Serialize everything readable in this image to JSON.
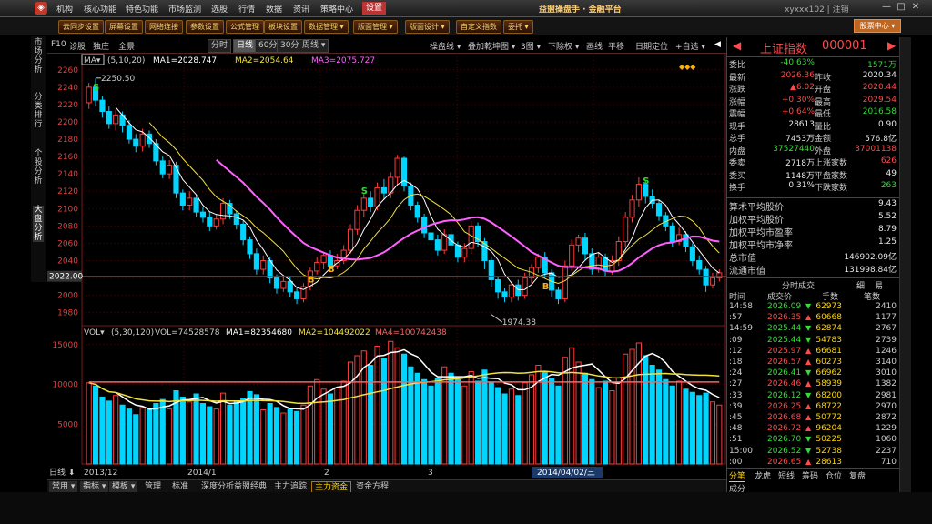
{
  "menu": {
    "items": [
      "机构",
      "核心功能",
      "特色功能",
      "市场监测",
      "选股",
      "行情",
      "数据",
      "资讯",
      "策略中心",
      "设置"
    ],
    "active_index": 9,
    "brand": "益盟操盘手 · 金融平台",
    "user": "xyxxx102 | 注销",
    "win_buttons": [
      "—",
      "□",
      "✕"
    ]
  },
  "toolbar": {
    "buttons": [
      "云同步设置",
      "屏幕设置",
      "网络连接",
      "参数设置",
      "公式管理",
      "板块设置",
      "数据管理 ▾",
      "版面管理 ▾",
      "版面设计 ▾",
      "自定义指数",
      "委托 ▾"
    ],
    "links": [
      "中国操盘手",
      "客服",
      "培训"
    ],
    "stock_center": "股票中心 ▾"
  },
  "vtabs": [
    "市场分析",
    "分类排行",
    "个股分析",
    "大盘分析"
  ],
  "chart_header": {
    "left": [
      "F10",
      "诊股",
      "独庄",
      "全景"
    ],
    "periods": [
      "分时",
      "日线",
      "60分",
      "30分",
      "周线 ▾"
    ],
    "selected_period": "日线",
    "right": [
      "操盘线 ▾",
      "叠加乾坤图 ▾",
      "3图 ▾",
      "下除权 ▾",
      "画线",
      "平移",
      "日期定位",
      "+自选 ▾"
    ]
  },
  "price_legend": {
    "ma_label": "MA▾",
    "params": "(5,10,20)",
    "ma1": "MA1=2028.747",
    "ma2": "MA2=2054.64",
    "ma3": "MA3=2075.727",
    "high_mark": "2250.50",
    "low_mark": "1974.38",
    "current_tag": "2022.00"
  },
  "vol_legend": {
    "label": "VOL▾",
    "params": "(5,30,120)",
    "vol": "VOL=74528578",
    "ma1": "MA1=82354680",
    "ma2": "MA2=104492022",
    "ma4": "MA4=100742438"
  },
  "x_axis": {
    "period_label": "日线",
    "ticks": [
      "2013/12",
      "2014/1",
      "2",
      "3"
    ],
    "cursor_date": "2014/04/02/三"
  },
  "bottom_tabs": [
    "常用 ▾",
    "指标 ▾",
    "模板 ▾",
    "管理",
    "标准",
    "深度分析",
    "益盟经典",
    "主力追踪",
    "主力资金",
    "资金方程"
  ],
  "bottom_active": "主力资金",
  "quote": {
    "name": "上证指数",
    "code": "000001",
    "rows": [
      {
        "l": "委比",
        "v": "-40.63%",
        "l2": "",
        "v2": "1571万",
        "vc": "grn",
        "v2c": "grn"
      },
      {
        "l": "最新",
        "v": "2026.36",
        "l2": "昨收",
        "v2": "2020.34",
        "vc": "red",
        "v2c": "wht"
      },
      {
        "l": "涨跌",
        "v": "▲6.02",
        "l2": "开盘",
        "v2": "2020.44",
        "vc": "red",
        "v2c": "red"
      },
      {
        "l": "涨幅",
        "v": "+0.30%",
        "l2": "最高",
        "v2": "2029.54",
        "vc": "red",
        "v2c": "red"
      },
      {
        "l": "震幅",
        "v": "+0.64%",
        "l2": "最低",
        "v2": "2016.58",
        "vc": "red",
        "v2c": "grn"
      },
      {
        "l": "现手",
        "v": "28613",
        "l2": "量比",
        "v2": "0.90",
        "vc": "wht",
        "v2c": "wht"
      },
      {
        "l": "总手",
        "v": "7453万",
        "l2": "金额",
        "v2": "576.8亿",
        "vc": "wht",
        "v2c": "wht"
      },
      {
        "l": "内盘",
        "v": "37527440",
        "l2": "外盘",
        "v2": "37001138",
        "vc": "grn",
        "v2c": "red"
      },
      {
        "l": "委卖",
        "v": "2718万",
        "l2": "上涨家数",
        "v2": "626",
        "vc": "wht",
        "v2c": "red"
      },
      {
        "l": "委买",
        "v": "1148万",
        "l2": "平盘家数",
        "v2": "49",
        "vc": "wht",
        "v2c": "wht"
      },
      {
        "l": "换手",
        "v": "0.31%",
        "l2": "下跌家数",
        "v2": "263",
        "vc": "wht",
        "v2c": "grn"
      }
    ],
    "stats": [
      {
        "l": "算术平均股价",
        "v": "9.43"
      },
      {
        "l": "加权平均股价",
        "v": "5.52"
      },
      {
        "l": "加权平均市盈率",
        "v": "8.79"
      },
      {
        "l": "加权平均市净率",
        "v": "1.25"
      },
      {
        "l": "总市值",
        "v": "146902.09亿"
      },
      {
        "l": "流通市值",
        "v": "131998.84亿"
      }
    ],
    "ticks_title": "分时成交",
    "ticks_tabs": [
      "细",
      "易"
    ],
    "ticks_headers": [
      "时间",
      "成交价",
      "手数",
      "笔数"
    ],
    "ticks": [
      {
        "t": "14:58",
        "p": "2026.09",
        "d": "▼",
        "h": "62973",
        "n": "2410"
      },
      {
        "t": ":57",
        "p": "2026.35",
        "d": "▲",
        "h": "60668",
        "n": "1177"
      },
      {
        "t": "14:59",
        "p": "2025.44",
        "d": "▼",
        "h": "62874",
        "n": "2767"
      },
      {
        "t": ":09",
        "p": "2025.44",
        "d": "▼",
        "h": "54783",
        "n": "2739"
      },
      {
        "t": ":12",
        "p": "2025.97",
        "d": "▲",
        "h": "66681",
        "n": "1246"
      },
      {
        "t": ":18",
        "p": "2026.57",
        "d": "▲",
        "h": "60273",
        "n": "3140"
      },
      {
        "t": ":24",
        "p": "2026.41",
        "d": "▼",
        "h": "66962",
        "n": "3010"
      },
      {
        "t": ":27",
        "p": "2026.46",
        "d": "▲",
        "h": "58939",
        "n": "1382"
      },
      {
        "t": ":33",
        "p": "2026.12",
        "d": "▼",
        "h": "68200",
        "n": "2981"
      },
      {
        "t": ":39",
        "p": "2026.25",
        "d": "▲",
        "h": "68722",
        "n": "2970"
      },
      {
        "t": ":45",
        "p": "2026.68",
        "d": "▲",
        "h": "50772",
        "n": "2872"
      },
      {
        "t": ":48",
        "p": "2026.72",
        "d": "▲",
        "h": "96204",
        "n": "1229"
      },
      {
        "t": ":51",
        "p": "2026.70",
        "d": "▼",
        "h": "50225",
        "n": "1060"
      },
      {
        "t": "15:00",
        "p": "2026.52",
        "d": "▼",
        "h": "52738",
        "n": "2237"
      },
      {
        "t": ":00",
        "p": "2026.65",
        "d": "▲",
        "h": "28613",
        "n": "710"
      }
    ],
    "bottom_tabs": [
      "分笔",
      "龙虎",
      "短线",
      "筹码",
      "仓位",
      "复盘"
    ],
    "bottom_tabs2": [
      "成分"
    ]
  },
  "colors": {
    "up": "#ff3b3b",
    "down": "#00d5ff",
    "ma1": "#ffffff",
    "ma2": "#f0e040",
    "ma3": "#ff60ff",
    "accent": "#b33"
  },
  "chart_data": {
    "type": "candlestick",
    "ylim": [
      1965,
      2265
    ],
    "yticks": [
      1980,
      2000,
      2020,
      2040,
      2060,
      2080,
      2100,
      2120,
      2140,
      2160,
      2180,
      2200,
      2220,
      2240,
      2260
    ],
    "vol_ylim": [
      0,
      16000000
    ],
    "vol_yticks": [
      5000000,
      10000000,
      15000000
    ],
    "vol_ytick_labels": [
      "5000",
      "10000",
      "15000"
    ],
    "candles": [
      [
        2222,
        2240,
        2245,
        2215
      ],
      [
        2240,
        2225,
        2250,
        2218
      ],
      [
        2225,
        2212,
        2230,
        2205
      ],
      [
        2212,
        2198,
        2218,
        2192
      ],
      [
        2198,
        2208,
        2214,
        2190
      ],
      [
        2208,
        2196,
        2212,
        2188
      ],
      [
        2196,
        2180,
        2202,
        2175
      ],
      [
        2180,
        2172,
        2186,
        2165
      ],
      [
        2172,
        2186,
        2192,
        2166
      ],
      [
        2186,
        2175,
        2190,
        2170
      ],
      [
        2175,
        2155,
        2180,
        2150
      ],
      [
        2155,
        2140,
        2160,
        2135
      ],
      [
        2140,
        2150,
        2156,
        2134
      ],
      [
        2150,
        2118,
        2154,
        2112
      ],
      [
        2118,
        2104,
        2122,
        2098
      ],
      [
        2104,
        2112,
        2120,
        2098
      ],
      [
        2112,
        2096,
        2116,
        2090
      ],
      [
        2096,
        2090,
        2102,
        2084
      ],
      [
        2090,
        2080,
        2096,
        2074
      ],
      [
        2080,
        2088,
        2094,
        2076
      ],
      [
        2088,
        2106,
        2112,
        2082
      ],
      [
        2106,
        2094,
        2110,
        2088
      ],
      [
        2094,
        2082,
        2098,
        2076
      ],
      [
        2082,
        2064,
        2086,
        2058
      ],
      [
        2064,
        2048,
        2068,
        2042
      ],
      [
        2048,
        2030,
        2054,
        2024
      ],
      [
        2030,
        2040,
        2046,
        2024
      ],
      [
        2040,
        2020,
        2044,
        2014
      ],
      [
        2020,
        2008,
        2024,
        2002
      ],
      [
        2008,
        2016,
        2022,
        2004
      ],
      [
        2016,
        2004,
        2022,
        1998
      ],
      [
        2004,
        1996,
        2008,
        1990
      ],
      [
        1996,
        2010,
        2014,
        1992
      ],
      [
        2010,
        2028,
        2032,
        2006
      ],
      [
        2028,
        2038,
        2044,
        2024
      ],
      [
        2038,
        2046,
        2050,
        2030
      ],
      [
        2046,
        2034,
        2052,
        2028
      ],
      [
        2034,
        2040,
        2048,
        2030
      ],
      [
        2040,
        2052,
        2058,
        2036
      ],
      [
        2052,
        2076,
        2082,
        2048
      ],
      [
        2076,
        2098,
        2104,
        2070
      ],
      [
        2098,
        2112,
        2118,
        2090
      ],
      [
        2112,
        2102,
        2120,
        2096
      ],
      [
        2102,
        2124,
        2130,
        2098
      ],
      [
        2124,
        2118,
        2134,
        2110
      ],
      [
        2118,
        2136,
        2142,
        2112
      ],
      [
        2136,
        2158,
        2162,
        2128
      ],
      [
        2158,
        2126,
        2160,
        2120
      ],
      [
        2126,
        2104,
        2130,
        2098
      ],
      [
        2104,
        2090,
        2108,
        2084
      ],
      [
        2090,
        2072,
        2094,
        2066
      ],
      [
        2072,
        2064,
        2078,
        2058
      ],
      [
        2064,
        2052,
        2070,
        2046
      ],
      [
        2052,
        2070,
        2076,
        2048
      ],
      [
        2070,
        2058,
        2076,
        2052
      ],
      [
        2058,
        2044,
        2062,
        2038
      ],
      [
        2044,
        2054,
        2060,
        2038
      ],
      [
        2054,
        2080,
        2086,
        2048
      ],
      [
        2080,
        2062,
        2084,
        2056
      ],
      [
        2062,
        2040,
        2066,
        2030
      ],
      [
        2040,
        2018,
        2044,
        2010
      ],
      [
        2018,
        2004,
        2022,
        1996
      ],
      [
        2004,
        1998,
        2008,
        1992
      ],
      [
        1998,
        2012,
        2016,
        1992
      ],
      [
        2012,
        2000,
        2018,
        1994
      ],
      [
        2000,
        2020,
        2026,
        1996
      ],
      [
        2020,
        2032,
        2036,
        2014
      ],
      [
        2032,
        2044,
        2048,
        2026
      ],
      [
        2044,
        2026,
        2050,
        2020
      ],
      [
        2026,
        2006,
        2030,
        1998
      ],
      [
        2006,
        1996,
        2010,
        1990
      ],
      [
        1996,
        2034,
        2040,
        1992
      ],
      [
        2034,
        2058,
        2064,
        2028
      ],
      [
        2058,
        2066,
        2070,
        2050
      ],
      [
        2066,
        2048,
        2072,
        2040
      ],
      [
        2048,
        2030,
        2054,
        2024
      ],
      [
        2030,
        2044,
        2050,
        2026
      ],
      [
        2044,
        2028,
        2048,
        2022
      ],
      [
        2028,
        2040,
        2046,
        2024
      ],
      [
        2040,
        2062,
        2068,
        2034
      ],
      [
        2062,
        2090,
        2096,
        2056
      ],
      [
        2090,
        2110,
        2116,
        2084
      ],
      [
        2110,
        2128,
        2136,
        2102
      ],
      [
        2128,
        2114,
        2132,
        2106
      ],
      [
        2114,
        2106,
        2122,
        2100
      ],
      [
        2106,
        2092,
        2110,
        2086
      ],
      [
        2092,
        2080,
        2096,
        2074
      ],
      [
        2080,
        2062,
        2084,
        2056
      ],
      [
        2062,
        2070,
        2078,
        2058
      ],
      [
        2070,
        2056,
        2074,
        2050
      ],
      [
        2056,
        2040,
        2060,
        2034
      ],
      [
        2040,
        2030,
        2046,
        2024
      ],
      [
        2030,
        2012,
        2034,
        2004
      ],
      [
        2012,
        2020,
        2026,
        2008
      ],
      [
        2020,
        2026,
        2030,
        2016
      ]
    ],
    "volumes": [
      10.2,
      9.8,
      8.4,
      7.9,
      8.6,
      7.4,
      6.9,
      6.2,
      7.1,
      6.8,
      7.6,
      8.1,
      6.9,
      9.2,
      8.4,
      7.8,
      8.8,
      7.6,
      7.2,
      6.9,
      8.9,
      7.4,
      7.8,
      8.2,
      9.1,
      8.7,
      6.8,
      7.6,
      7.1,
      6.4,
      6.9,
      6.6,
      7.4,
      9.8,
      10.6,
      9.4,
      8.8,
      9.6,
      10.4,
      12.8,
      13.6,
      14.2,
      12.4,
      14.8,
      13.2,
      15.4,
      14.6,
      13.8,
      12.2,
      11.4,
      10.6,
      9.8,
      10.8,
      12.2,
      11.4,
      10.6,
      9.8,
      11.6,
      10.4,
      11.8,
      10.2,
      9.6,
      8.8,
      9.4,
      8.6,
      10.2,
      11.2,
      12.4,
      11.6,
      10.8,
      9.8,
      13.4,
      14.6,
      12.8,
      11.4,
      10.6,
      9.6,
      10.4,
      9.2,
      10.8,
      13.8,
      14.4,
      15.2,
      13.6,
      12.4,
      11.8,
      10.6,
      9.8,
      10.4,
      9.4,
      9.0,
      8.6,
      8.9,
      7.8,
      7.4
    ]
  }
}
